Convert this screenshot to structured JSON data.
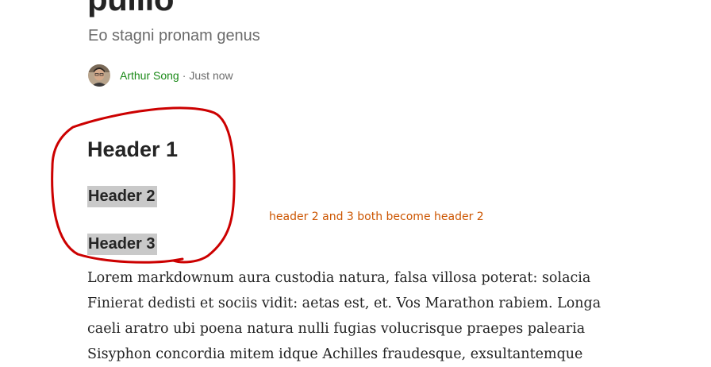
{
  "article": {
    "title": "pulilo",
    "subtitle": "Eo stagni pronam genus",
    "author": "Arthur Song",
    "separator": "·",
    "time": "Just now"
  },
  "headers": {
    "h1": "Header 1",
    "h2": "Header 2",
    "h3": "Header 3"
  },
  "annotation": {
    "text": "header 2 and 3 both become header 2",
    "color": "#cc5500",
    "circle_color": "#cc0000"
  },
  "body": {
    "lines": [
      "Lorem markdownum aura custodia natura, falsa villosa poterat: solacia",
      "Finierat dedisti et sociis vidit: aetas est, et. Vos Marathon rabiem. Longa",
      "caeli aratro ubi poena natura nulli fugias volucrisque praepes palearia",
      "Sisyphon concordia mitem idque Achilles fraudesque, exsultantemque"
    ]
  },
  "colors": {
    "author_link": "#1a8917",
    "highlight": "#c9c9c9",
    "text": "#242424",
    "muted": "#6b6b6b"
  }
}
